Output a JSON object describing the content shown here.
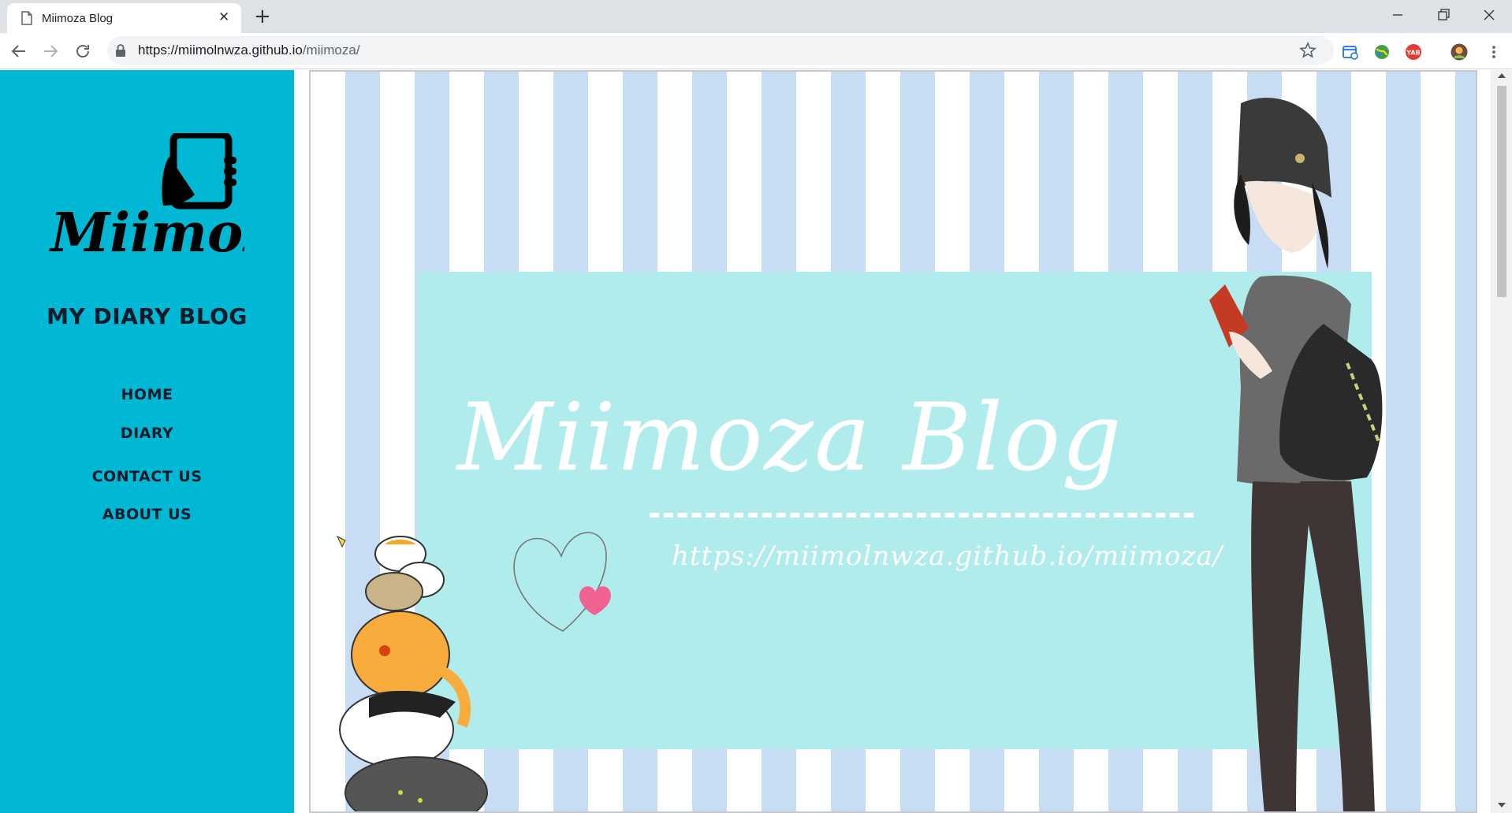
{
  "browser": {
    "tab_title": "Miimoza Blog",
    "tab_icon": "page-icon",
    "close_tab": "✕",
    "new_tab": "+",
    "url_host": "https://miimolnwza.github.io",
    "url_path": "/miimoza/",
    "window_controls": [
      "minimize-icon",
      "restore-icon",
      "close-icon"
    ],
    "extensions": [
      "calendar-extension-icon",
      "globe-extension-icon",
      "yab-extension-icon",
      "profile-avatar"
    ],
    "extension_labels": {
      "yab": "YAB"
    }
  },
  "sidebar": {
    "logo_text": "Miimoza",
    "blog_title": "MY DIARY BLOG",
    "nav_items": [
      {
        "label": "HOME"
      },
      {
        "label": "DIARY"
      },
      {
        "label": "CONTACT US"
      },
      {
        "label": "ABOUT US"
      }
    ],
    "background_color": "#00b8d4"
  },
  "banner": {
    "title": "Miimoza Blog",
    "url_text": "https://miimolnwza.github.io/miimoza/",
    "stripe_color": "#c8dcf3",
    "panel_color": "#b0ecec"
  }
}
